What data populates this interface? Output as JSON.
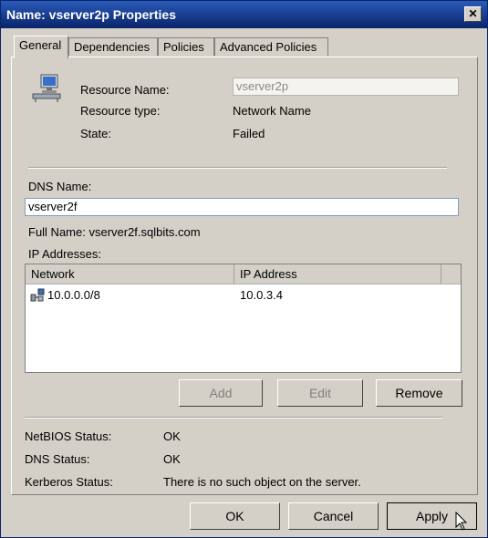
{
  "window": {
    "title": "Name: vserver2p Properties",
    "close_glyph": "✕"
  },
  "tabs": [
    {
      "label": "General"
    },
    {
      "label": "Dependencies"
    },
    {
      "label": "Policies"
    },
    {
      "label": "Advanced Policies"
    }
  ],
  "resource": {
    "name_label": "Resource Name:",
    "name_value": "vserver2p",
    "type_label": "Resource type:",
    "type_value": "Network Name",
    "state_label": "State:",
    "state_value": "Failed"
  },
  "dns": {
    "label": "DNS Name:",
    "value": "vserver2f",
    "full_name": "Full Name: vserver2f.sqlbits.com"
  },
  "ip": {
    "label": "IP Addresses:",
    "columns": [
      "Network",
      "IP Address"
    ],
    "rows": [
      {
        "network": "10.0.0.0/8",
        "address": "10.0.3.4"
      }
    ],
    "add_label": "Add",
    "edit_label": "Edit",
    "remove_label": "Remove"
  },
  "status": {
    "netbios_label": "NetBIOS Status:",
    "netbios_value": "OK",
    "dns_label": "DNS Status:",
    "dns_value": "OK",
    "kerberos_label": "Kerberos Status:",
    "kerberos_value": "There is no such object on the server."
  },
  "footer": {
    "ok_label": "OK",
    "cancel_label": "Cancel",
    "apply_label": "Apply"
  }
}
